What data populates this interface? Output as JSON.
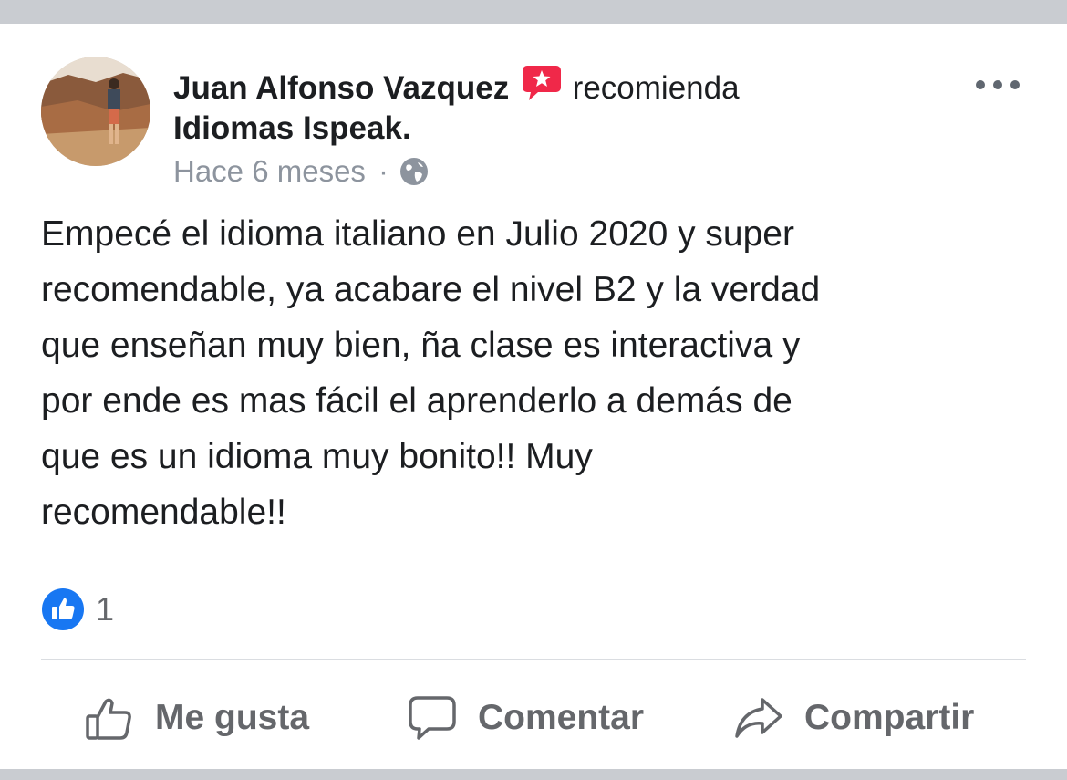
{
  "post": {
    "author": "Juan Alfonso Vazquez",
    "recommends_text": "recomienda",
    "page_name": "Idiomas Ispeak.",
    "timestamp": "Hace 6 meses",
    "separator": "·",
    "privacy_icon": "globe-icon",
    "body": "Empecé el idioma italiano en Julio 2020 y super\nrecomendable, ya acabare el nivel B2 y la verdad\nque enseñan muy bien, ña clase es interactiva y\npor ende es mas fácil el aprenderlo a demás de\nque es un idioma muy bonito!! Muy\nrecomendable!!",
    "reaction_count": "1"
  },
  "actions": {
    "like_label": "Me gusta",
    "comment_label": "Comentar",
    "share_label": "Compartir"
  },
  "colors": {
    "background": "#c9ccd1",
    "card": "#ffffff",
    "text": "#1c1e21",
    "secondary_text": "#8d949e",
    "action_text": "#65676b",
    "like_blue": "#1877f2",
    "recommend_red": "#f02849"
  }
}
